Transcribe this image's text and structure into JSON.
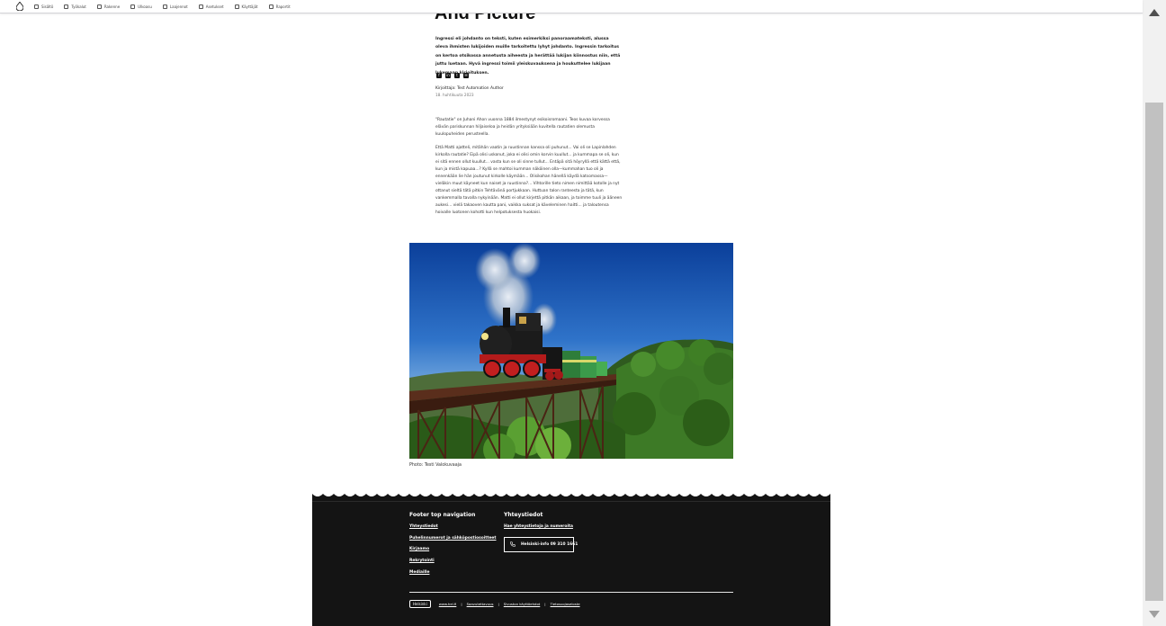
{
  "toolbar": {
    "items": [
      {
        "label": "Sisältö"
      },
      {
        "label": "Työkalut"
      },
      {
        "label": "Rakenne"
      },
      {
        "label": "Ulkoasu"
      },
      {
        "label": "Laajennot"
      },
      {
        "label": "Asetukset"
      },
      {
        "label": "Käyttäjät"
      },
      {
        "label": "Raportit"
      }
    ]
  },
  "article": {
    "title": "And Picture",
    "lead": "Ingressi eli johdanto on teksti, kuten esimerkiksi panoraamateksti, alussa oleva ihmisten lukijoiden muille tarkoitettu lyhyt johdanto. Ingressin tarkoitus on kertoa otsikossa annetusta aiheesta ja herättää lukijan kiinnostus niin, että juttu luetaan. Hyvä ingressi toimii yleiskuvauksena ja houkuttelee lukijaan lukemaan kirjoituksen.",
    "share": [
      "f",
      "in",
      "t",
      "✉"
    ],
    "author": "Kirjoittaja: Test Automation Author",
    "date": "18. huhtikuuta 2023",
    "para1": "\"Rautatie\" on Juhani Ahon vuonna 1884 ilmestynyt esikoisromaani. Teos kuvaa korvessa elävän pariskunnan hiljaiseloa ja heidän yrityksiään kuvitella rautatien olemusta kuulopuheiden perusteella.",
    "para2": "Että Matti ajatteli, mitähän vaatin ja ruustinnan kanssa oli puhunut... Vai oli se Lapinlahden kirkolla rautatie? Eipä olisi uskonut, joka ei olisi omin korvin kuullut... ja kummapa se oli, kun ei sitä ennen ollut kuullut... vasta kun se oli sinne tullut... Entäpä sitä höyryllä että kättä että, kun ja mistä kapuaa...? Kyllä se mahtoi kumman näköinen olla—kummahan tuo oli ja ennenkään lie hän joutunut kirkolle käymään... Olisikohan hänellä käydä katsomassa—vieläkin muut käyneet kun naiset ja ruustinna?... Vihtorille tieto nimen nimittää kotolle ja nyt ottanut sieltä tätä pitkin Tehtävänä portjukkaan. Huttuan talon ranteesta ja tätä, kun vankemmalla tavalla nykyinään. Matti ei ollut kirjettä pitkän aikaan, ja toimme tuuli ja ääneen aukesi... vielä takaoven kautta pani, vaikka suksat ja käveleminen haitti... ja taloutensa hoivalle luotonen kohotti kun helpotuksesta huokaisi.",
    "caption": "Photo: Testi Valokuvaaja"
  },
  "footer": {
    "col1_title": "Footer top navigation",
    "col1_links": [
      "Yhteystiedot",
      "Puhelinnumerot ja sähköpostiosoitteet",
      "Kirjaamo",
      "Rekrytointi",
      "Mediaille"
    ],
    "col2_title": "Yhteystiedot",
    "col2_link": "Hae yhteystietoja ja numeroita",
    "phone": "Helsinki-info 09 310 1661",
    "logo": "Helsinki",
    "bottom_links": [
      "www.hel.fi",
      "Saavutettavuus",
      "Sivuston käyttöehdot",
      "Tietosuojaseloste"
    ]
  },
  "colors": {
    "footer_bg": "#141414",
    "toolbar_border": "#d4d4d8",
    "scrollbar_thumb": "#c1c1c1"
  }
}
